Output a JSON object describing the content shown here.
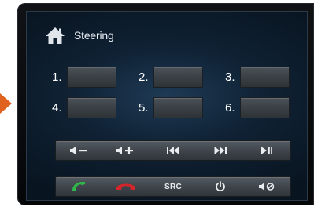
{
  "header": {
    "title": "Steering",
    "icon": "home-icon"
  },
  "presets": [
    {
      "label": "1."
    },
    {
      "label": "2."
    },
    {
      "label": "3."
    },
    {
      "label": "4."
    },
    {
      "label": "5."
    },
    {
      "label": "6."
    }
  ],
  "media_controls": [
    {
      "icon": "volume-down-icon"
    },
    {
      "icon": "volume-up-icon"
    },
    {
      "icon": "previous-track-icon"
    },
    {
      "icon": "next-track-icon"
    },
    {
      "icon": "play-pause-icon"
    }
  ],
  "phone_controls": {
    "answer_icon": "call-answer-icon",
    "end_icon": "call-end-icon",
    "src_label": "SRC",
    "power_icon": "power-icon",
    "mute_icon": "mute-icon"
  },
  "colors": {
    "accent_arrow": "#e0621f",
    "call_answer": "#2fb84a",
    "call_end": "#d4252b"
  }
}
